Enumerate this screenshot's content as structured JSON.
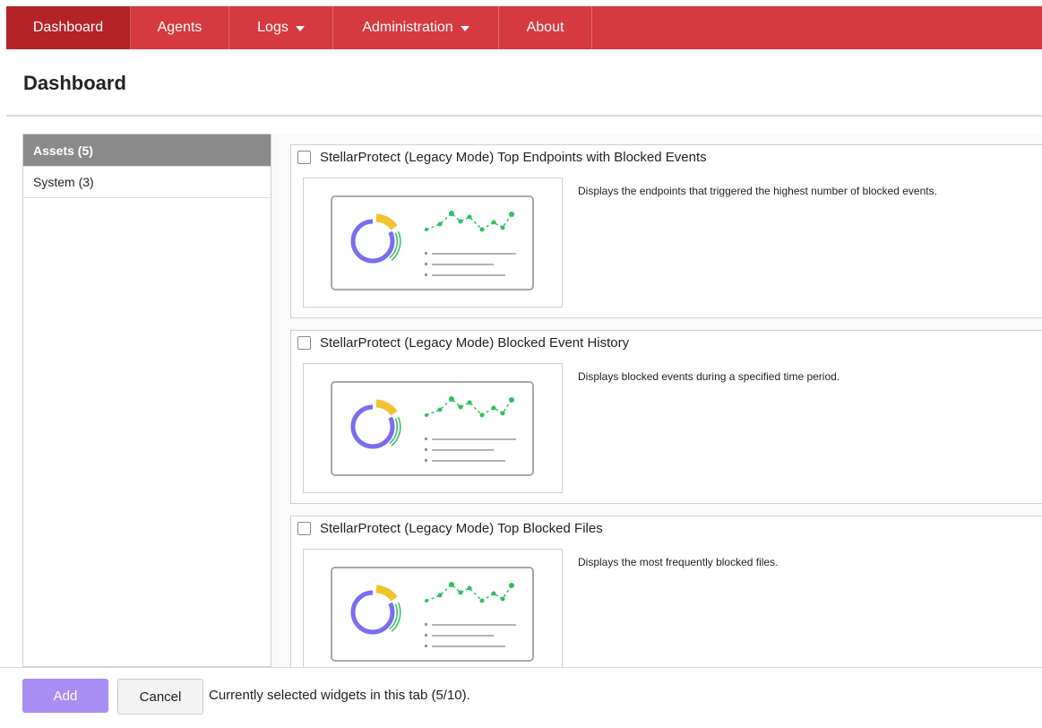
{
  "nav": {
    "items": [
      {
        "label": "Dashboard",
        "active": true,
        "has_dropdown": false
      },
      {
        "label": "Agents",
        "active": false,
        "has_dropdown": false
      },
      {
        "label": "Logs",
        "active": false,
        "has_dropdown": true
      },
      {
        "label": "Administration",
        "active": false,
        "has_dropdown": true
      },
      {
        "label": "About",
        "active": false,
        "has_dropdown": false
      }
    ],
    "bg_color": "#d43a3f",
    "active_color": "#b32328"
  },
  "page": {
    "title": "Dashboard"
  },
  "sidebar": {
    "items": [
      {
        "label": "Assets (5)",
        "active": true
      },
      {
        "label": "System (3)",
        "active": false
      }
    ]
  },
  "widgets": [
    {
      "title": "StellarProtect (Legacy Mode) Top Endpoints with Blocked Events",
      "description": "Displays the endpoints that triggered the highest number of blocked events.",
      "checked": false,
      "thumbnail_icon": "dashboard-widget-preview-icon"
    },
    {
      "title": "StellarProtect (Legacy Mode) Blocked Event History",
      "description": "Displays blocked events during a specified time period.",
      "checked": false,
      "thumbnail_icon": "dashboard-widget-preview-icon"
    },
    {
      "title": "StellarProtect (Legacy Mode) Top Blocked Files",
      "description": "Displays the most frequently blocked files.",
      "checked": false,
      "thumbnail_icon": "dashboard-widget-preview-icon"
    }
  ],
  "footer": {
    "add_label": "Add",
    "cancel_label": "Cancel",
    "status_text": "Currently selected widgets in this tab (5/10)."
  },
  "colors": {
    "accent": "#a88ef2",
    "donut_purple": "#7b6cf0",
    "donut_yellow": "#f2c230",
    "donut_green": "#2fbf5f"
  }
}
